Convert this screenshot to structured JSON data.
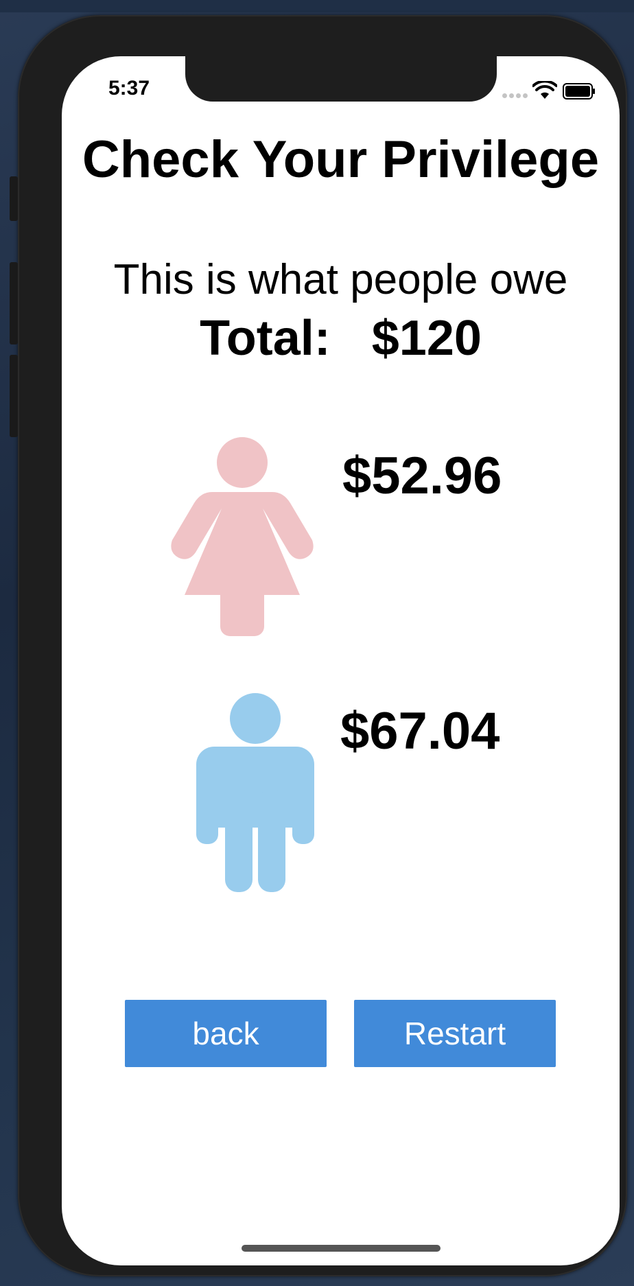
{
  "status_bar": {
    "time": "5:37"
  },
  "header": {
    "title": "Check Your Privilege",
    "subtitle": "This is what people owe",
    "total_label": "Total:",
    "total_value": "$120"
  },
  "breakdown": {
    "female": {
      "icon": "female-person-icon",
      "amount": "$52.96",
      "color": "#f0c3c6"
    },
    "male": {
      "icon": "male-person-icon",
      "amount": "$67.04",
      "color": "#98cced"
    }
  },
  "buttons": {
    "back_label": "back",
    "restart_label": "Restart",
    "color": "#418ad9"
  }
}
